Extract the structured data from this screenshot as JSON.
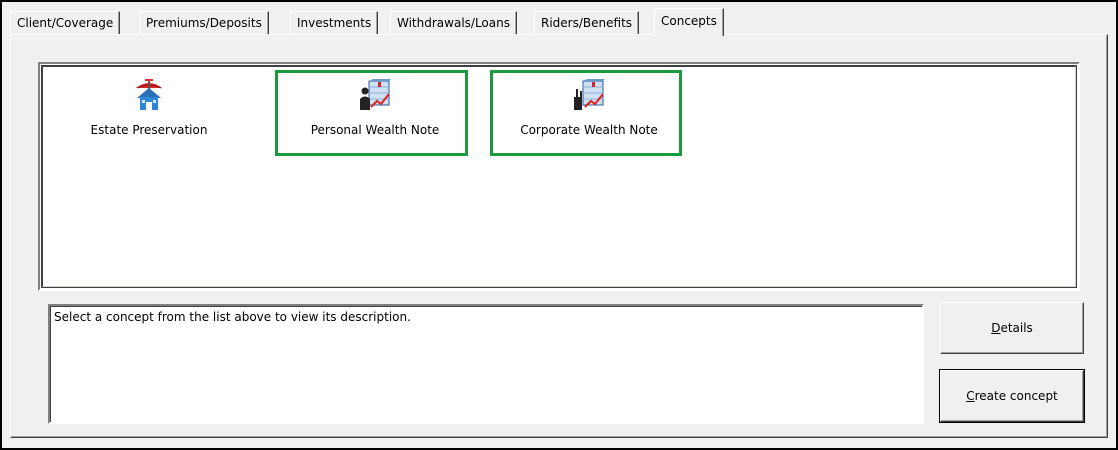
{
  "tabs": [
    {
      "label": "Client/Coverage"
    },
    {
      "label": "Premiums/Deposits"
    },
    {
      "label": "Investments"
    },
    {
      "label": "Withdrawals/Loans"
    },
    {
      "label": "Riders/Benefits"
    },
    {
      "label": "Concepts",
      "active": true
    }
  ],
  "concepts": [
    {
      "label": "Estate Preservation",
      "icon": "estate-house-umbrella-icon"
    },
    {
      "label": "Personal Wealth Note",
      "icon": "personal-wealth-chart-icon",
      "highlighted": true
    },
    {
      "label": "Corporate Wealth Note",
      "icon": "corporate-wealth-chart-icon",
      "highlighted": true
    }
  ],
  "description": {
    "text": "Select a concept from the list above to view its description."
  },
  "buttons": {
    "details": {
      "mnemonic": "D",
      "rest": "etails"
    },
    "create": {
      "mnemonic": "C",
      "rest": "reate concept"
    }
  },
  "colors": {
    "highlight_border": "#1b9a3c",
    "window_bg": "#f0f0f0"
  }
}
